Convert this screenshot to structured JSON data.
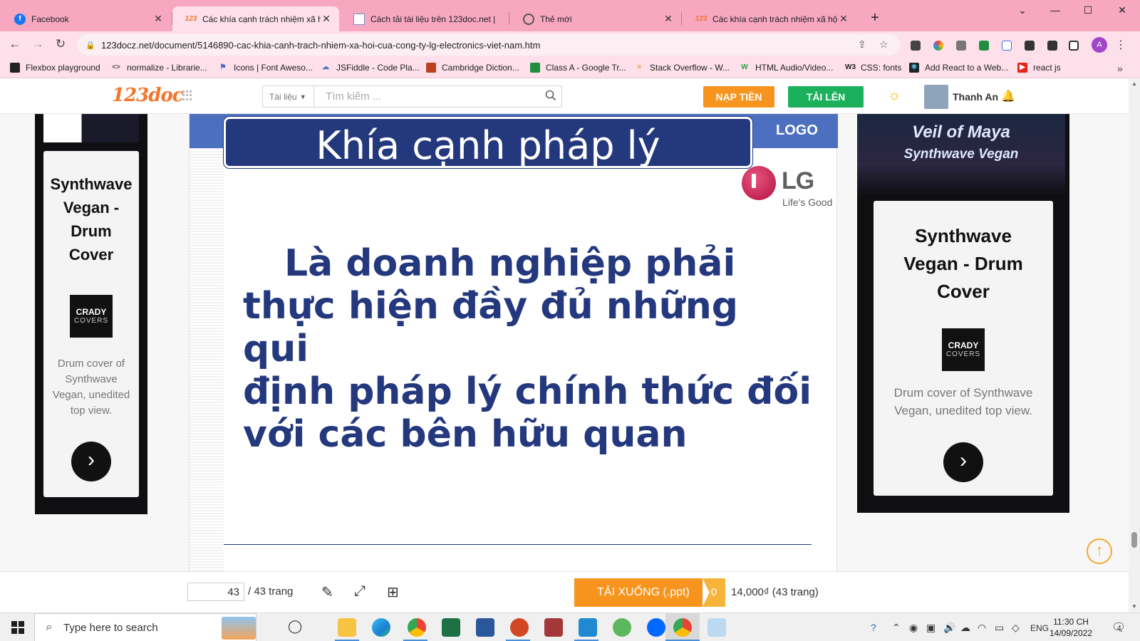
{
  "browser": {
    "tabs": [
      {
        "title": "Facebook",
        "favicon": "facebook-icon",
        "active": false
      },
      {
        "title": "Các khía cạnh trách nhiệm xã hội",
        "favicon": "123doc-icon",
        "active": true
      },
      {
        "title": "Cách tải tài liệu trên 123doc.net |",
        "favicon": "doc-icon",
        "active": false
      },
      {
        "title": "Thẻ mới",
        "favicon": "chrome-icon",
        "active": false
      },
      {
        "title": "Các khía cạnh trách nhiệm xã hội",
        "favicon": "123doc-icon",
        "active": false
      }
    ],
    "url": "123docz.net/document/5146890-cac-khia-canh-trach-nhiem-xa-hoi-cua-cong-ty-lg-electronics-viet-nam.htm",
    "bookmarks": [
      "Flexbox playground",
      "normalize - Librarie...",
      "Icons | Font Aweso...",
      "JSFiddle - Code Pla...",
      "Cambridge Diction...",
      "Class A - Google Tr...",
      "Stack Overflow - W...",
      "HTML Audio/Video...",
      "CSS: fonts",
      "Add React to a Web...",
      "react js"
    ],
    "profile_initial": "A"
  },
  "site": {
    "logo": "123doc",
    "category_label": "Tài liệu",
    "search_placeholder": "Tìm kiếm ...",
    "nap_tien": "NẠP TIỀN",
    "tai_len": "TẢI LÊN",
    "user_name": "Thanh An"
  },
  "ads": {
    "left": {
      "title": "Synthwave Vegan - Drum Cover",
      "logo_top": "CRADY",
      "logo_bottom": "COVERS",
      "desc": "Drum cover of Synthwave Vegan, unedited top view."
    },
    "right": {
      "banner_line1": "Veil of Maya",
      "banner_line2": "Synthwave Vegan",
      "title": "Synthwave Vegan - Drum Cover",
      "logo_top": "CRADY",
      "logo_bottom": "COVERS",
      "desc": "Drum cover of Synthwave Vegan, unedited top view."
    }
  },
  "slide": {
    "title": "Khía cạnh pháp lý",
    "logo_placeholder": "LOGO",
    "brand": "LG",
    "slogan": "Life's Good",
    "body_line1": "Là doanh nghiệp phải",
    "body_line2": "thực hiện đầy đủ những qui",
    "body_line3": "định pháp lý chính thức đối",
    "body_line4": "với các bên hữu quan"
  },
  "docbar": {
    "current_page": "43",
    "total_pages": "/ 43 trang",
    "download_label": "TẢI XUỐNG (.ppt)",
    "download_count": "0",
    "price": "14,000₫  (43 trang)"
  },
  "taskbar": {
    "search_placeholder": "Type here to search",
    "language": "ENG",
    "time": "11:30 CH",
    "date": "14/09/2022",
    "notification_count": "4"
  },
  "colors": {
    "tab_strip": "#f7a8c0",
    "toolbar": "#fde0ea",
    "slide_navy": "#24387e",
    "orange": "#f7941d",
    "green": "#1bb15c"
  }
}
